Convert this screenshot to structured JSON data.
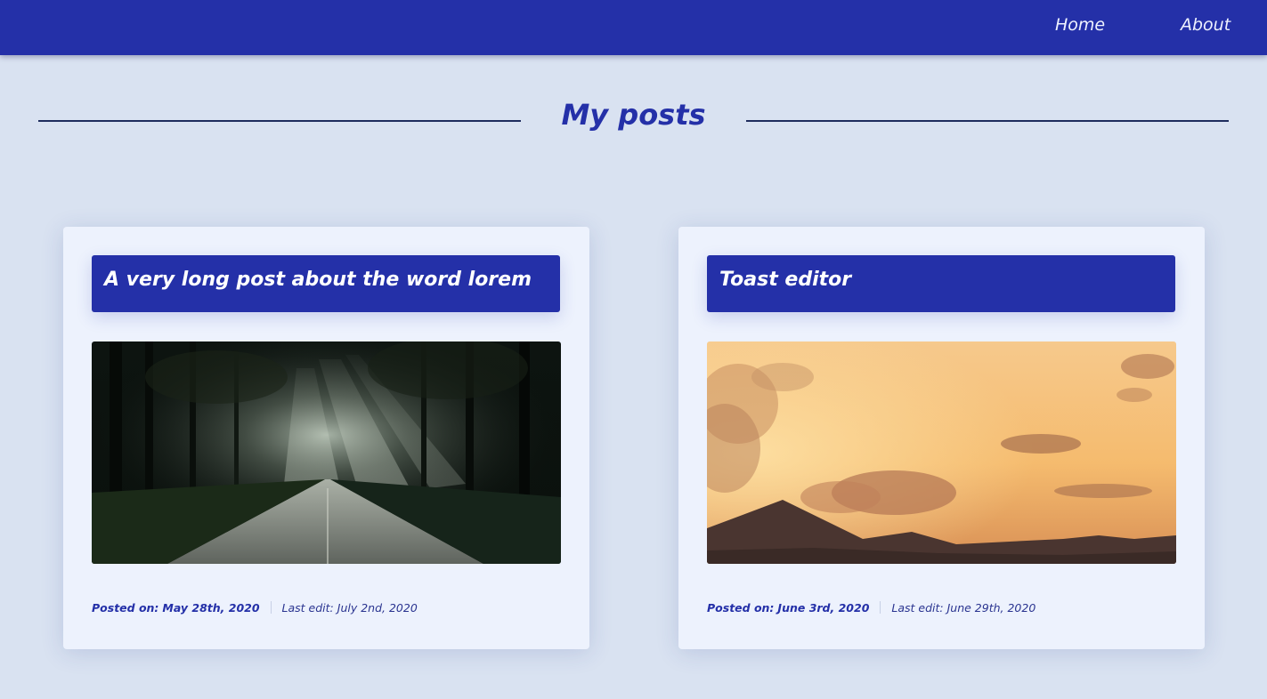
{
  "nav": {
    "items": [
      {
        "label": "Home"
      },
      {
        "label": "About"
      }
    ]
  },
  "page": {
    "title": "My posts"
  },
  "posts": [
    {
      "title": "A very long post about the word lorem",
      "image_icon": "forest-road-photo",
      "posted_label": "Posted on:",
      "posted_date": "May 28th, 2020",
      "edit_label": "Last edit:",
      "edit_date": "July 2nd, 2020"
    },
    {
      "title": "Toast editor",
      "image_icon": "sunset-mountains-photo",
      "posted_label": "Posted on:",
      "posted_date": "June 3rd, 2020",
      "edit_label": "Last edit:",
      "edit_date": "June 29th, 2020"
    }
  ],
  "colors": {
    "navbar": "#2430a8",
    "background": "#d9e2f1",
    "card": "#edf2fd",
    "title_band": "#2430a8",
    "accent_text": "#2430a8"
  }
}
